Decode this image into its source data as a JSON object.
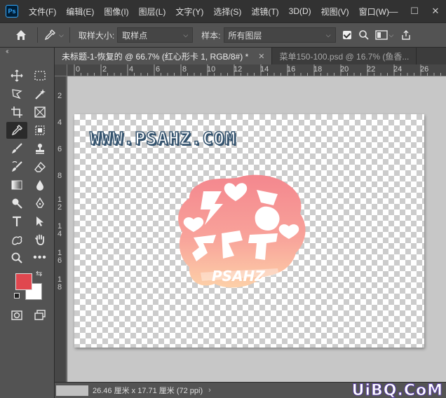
{
  "app": {
    "logo": "Ps"
  },
  "menu": [
    "文件(F)",
    "编辑(E)",
    "图像(I)",
    "图层(L)",
    "文字(Y)",
    "选择(S)",
    "滤镜(T)",
    "3D(D)",
    "视图(V)",
    "窗口(W)"
  ],
  "window_controls": {
    "minimize": "—",
    "maximize": "☐",
    "close": "✕"
  },
  "options": {
    "sample_size_label": "取样大小:",
    "sample_size_value": "取样点",
    "sample_label": "样本:",
    "sample_value": "所有图层",
    "show_ring_checked": true
  },
  "tabs": [
    {
      "label": "未标题-1-恢复的 @ 66.7% (红心形卡 1, RGB/8#) *",
      "active": true
    },
    {
      "label": "菜单150-100.psd @ 16.7% (鱼香...",
      "active": false
    }
  ],
  "ruler": {
    "h_ticks": [
      "0",
      "2",
      "4",
      "6",
      "8",
      "10",
      "12",
      "14",
      "16",
      "18",
      "20",
      "22",
      "24",
      "26"
    ],
    "v_ticks": [
      "2",
      "4",
      "6",
      "8",
      "1",
      "2",
      "1",
      "4",
      "1",
      "6",
      "1",
      "8"
    ]
  },
  "canvas": {
    "watermark": "WWW.PSAHZ.COM",
    "sticker_text": "PSAHZ",
    "colors": {
      "sticker_pink": "#f4888e",
      "sticker_peach": "#fcc9a4"
    }
  },
  "colors": {
    "foreground": "#e0474f",
    "background": "#ffffff"
  },
  "status": {
    "dimensions": "26.46 厘米 x 17.71 厘米 (72 ppi)",
    "arrow": "›"
  },
  "site_mark": "UiBQ.CoM"
}
